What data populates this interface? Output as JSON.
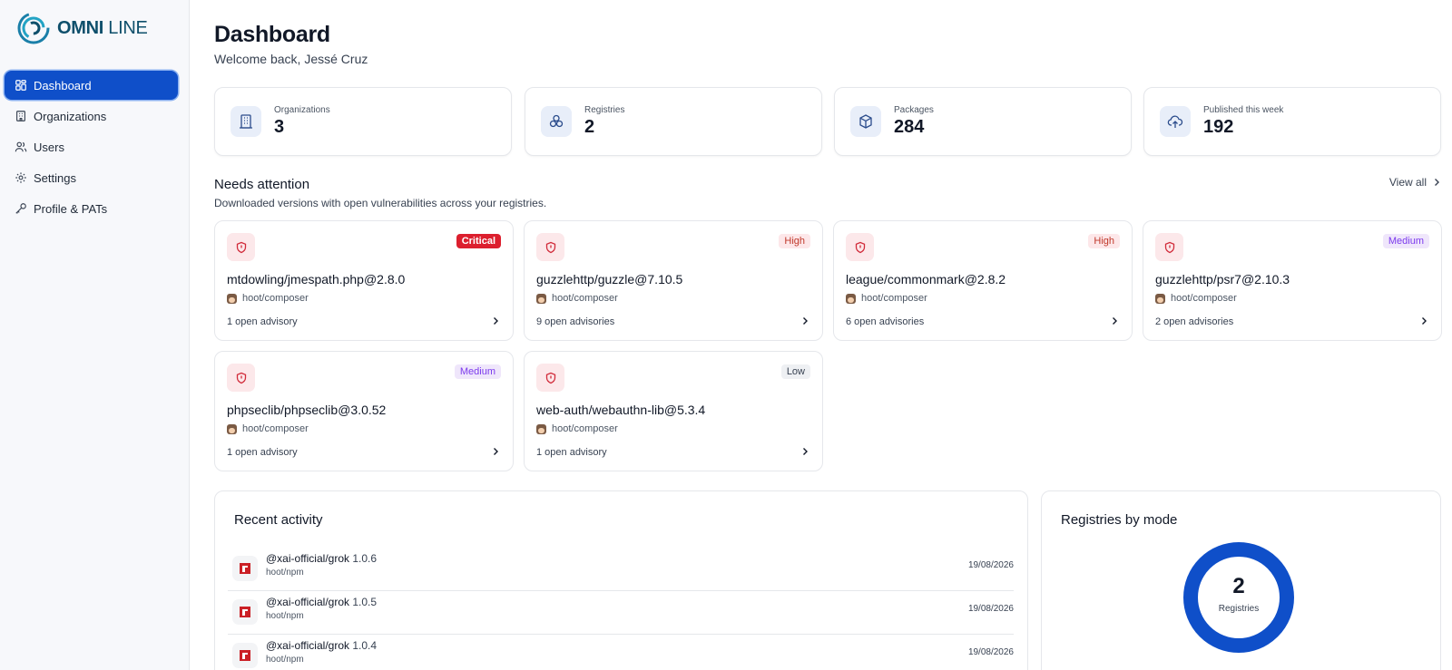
{
  "brand": {
    "name_bold": "OMNI",
    "name_light": "LINE"
  },
  "sidebar": {
    "items": [
      {
        "label": "Dashboard",
        "icon": "grid-icon",
        "active": true
      },
      {
        "label": "Organizations",
        "icon": "building-icon"
      },
      {
        "label": "Users",
        "icon": "users-icon"
      },
      {
        "label": "Settings",
        "icon": "gear-icon"
      },
      {
        "label": "Profile & PATs",
        "icon": "key-icon"
      }
    ]
  },
  "header": {
    "title": "Dashboard",
    "welcome": "Welcome back, Jessé Cruz"
  },
  "stats": [
    {
      "label": "Organizations",
      "value": "3",
      "icon": "building-icon"
    },
    {
      "label": "Registries",
      "value": "2",
      "icon": "boxes-icon"
    },
    {
      "label": "Packages",
      "value": "284",
      "icon": "package-icon"
    },
    {
      "label": "Published this week",
      "value": "192",
      "icon": "cloud-upload-icon"
    }
  ],
  "attention": {
    "title": "Needs attention",
    "subtitle": "Downloaded versions with open vulnerabilities across your registries.",
    "view_all": "View all",
    "cards": [
      {
        "package": "mtdowling/jmespath.php@2.8.0",
        "registry": "hoot/composer",
        "advisories": "1 open advisory",
        "severity": "Critical"
      },
      {
        "package": "guzzlehttp/guzzle@7.10.5",
        "registry": "hoot/composer",
        "advisories": "9 open advisories",
        "severity": "High"
      },
      {
        "package": "league/commonmark@2.8.2",
        "registry": "hoot/composer",
        "advisories": "6 open advisories",
        "severity": "High"
      },
      {
        "package": "guzzlehttp/psr7@2.10.3",
        "registry": "hoot/composer",
        "advisories": "2 open advisories",
        "severity": "Medium"
      },
      {
        "package": "phpseclib/phpseclib@3.0.52",
        "registry": "hoot/composer",
        "advisories": "1 open advisory",
        "severity": "Medium"
      },
      {
        "package": "web-auth/webauthn-lib@5.3.4",
        "registry": "hoot/composer",
        "advisories": "1 open advisory",
        "severity": "Low"
      }
    ]
  },
  "colors": {
    "accent": "#0f4fc9",
    "critical": "#dc1f2e",
    "high_text": "#c0392b",
    "medium_text": "#7c3aed",
    "npm": "#cb2026"
  },
  "activity": {
    "title": "Recent activity",
    "rows": [
      {
        "name": "@xai-official/grok",
        "version": "1.0.6",
        "registry": "hoot/npm",
        "date": "19/08/2026"
      },
      {
        "name": "@xai-official/grok",
        "version": "1.0.5",
        "registry": "hoot/npm",
        "date": "19/08/2026"
      },
      {
        "name": "@xai-official/grok",
        "version": "1.0.4",
        "registry": "hoot/npm",
        "date": "19/08/2026"
      }
    ]
  },
  "registries_by_mode": {
    "title": "Registries by mode",
    "total": "2",
    "total_label": "Registries"
  }
}
